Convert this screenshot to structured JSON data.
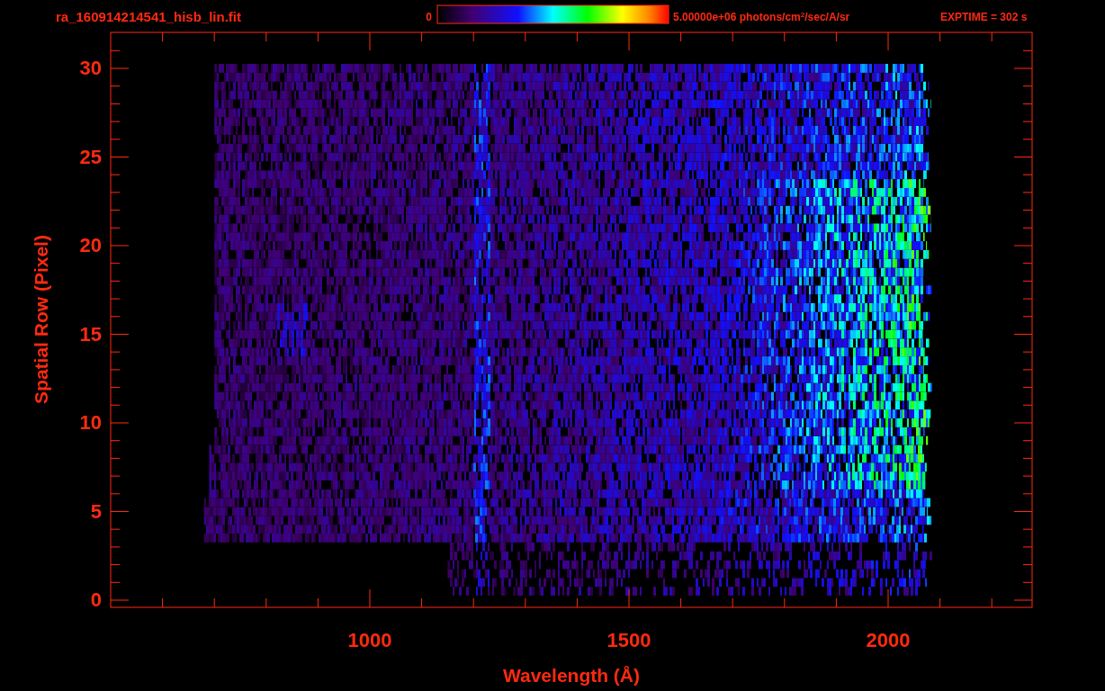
{
  "header": {
    "filename": "ra_160914214541_hisb_lin.fit",
    "colorbar": {
      "min_label": "0",
      "max_label": "5.00000e+06 photons/cm$^{2}$/sec/A/sr"
    },
    "exposure": "EXPTIME = 302 s"
  },
  "plot": {
    "xlabel": "Wavelength (Å)",
    "ylabel": "Spatial Row (Pixel)",
    "xticks": [
      "1000",
      "1500",
      "2000"
    ],
    "yticks": [
      "30",
      "25",
      "20",
      "15",
      "10",
      "5",
      "0"
    ]
  }
}
